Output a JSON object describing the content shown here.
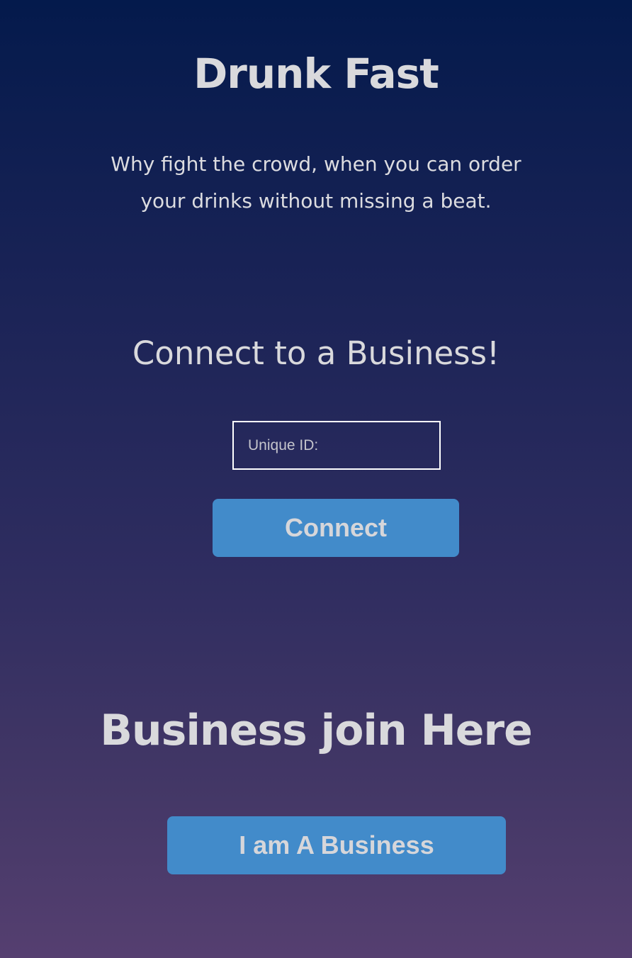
{
  "app": {
    "title": "Drunk Fast",
    "tagline": "Why fight the crowd, when you can order your drinks without missing a beat."
  },
  "connect": {
    "heading": "Connect to a Business!",
    "id_placeholder": "Unique ID:",
    "id_value": "",
    "button_label": "Connect"
  },
  "business": {
    "heading": "Business join Here",
    "button_label": "I am A Business"
  },
  "colors": {
    "background_top": "#041a4c",
    "background_bottom": "#553f70",
    "button": "#428bca",
    "text": "#d9d9dc"
  }
}
